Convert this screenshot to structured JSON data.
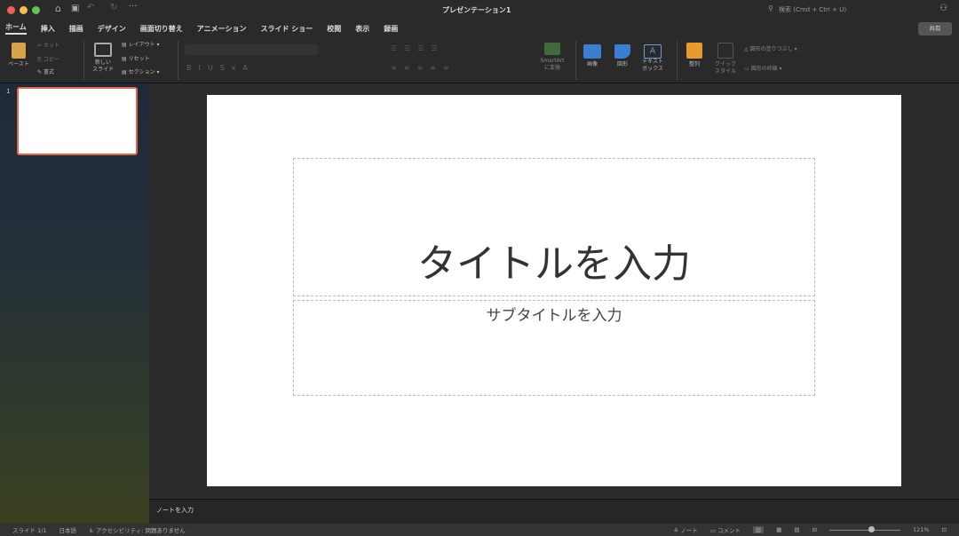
{
  "window": {
    "title": "プレゼンテーション1",
    "search_placeholder": "検索 (Cmd + Ctrl + U)",
    "share": "共有"
  },
  "tabs": [
    "ホーム",
    "挿入",
    "描画",
    "デザイン",
    "画面切り替え",
    "アニメーション",
    "スライド ショー",
    "校閲",
    "表示",
    "録画"
  ],
  "ribbon": {
    "paste": "ペースト",
    "cut": "カット",
    "copy": "コピー",
    "format": "書式",
    "new_slide_1": "新しい",
    "new_slide_2": "スライド",
    "layout": "レイアウト",
    "reset": "リセット",
    "section": "セクション",
    "smartart_1": "SmartArt",
    "smartart_2": "に変換",
    "picture": "画像",
    "shapes": "図形",
    "textbox_1": "テキスト",
    "textbox_2": "ボックス",
    "arrange": "整列",
    "quick_1": "クイック",
    "quick_2": "スタイル",
    "shape_fill": "図形の塗りつぶし",
    "shape_outline": "図形の枠線"
  },
  "slides": {
    "number": "1"
  },
  "slide": {
    "title_placeholder": "タイトルを入力",
    "subtitle_placeholder": "サブタイトルを入力"
  },
  "notes": {
    "placeholder": "ノートを入力"
  },
  "status": {
    "slide": "スライド 1/1",
    "language": "日本語",
    "accessibility": "アクセシビリティ: 問題ありません",
    "notes": "ノート",
    "comments": "コメント",
    "zoom": "121%",
    "zoom_fraction": 0.6
  }
}
